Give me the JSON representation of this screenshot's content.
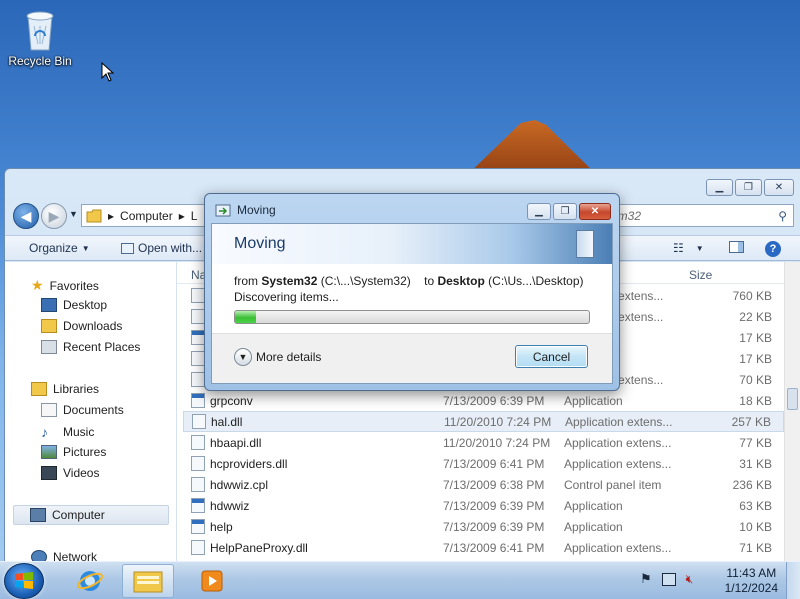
{
  "desktop": {
    "recycle_bin_label": "Recycle Bin"
  },
  "explorer": {
    "address": [
      "Computer",
      "L"
    ],
    "search_text": "em32",
    "toolbar": {
      "organize": "Organize",
      "open_with": "Open with..."
    },
    "columns": {
      "name": "Na",
      "size": "Size"
    },
    "nav": {
      "favorites": "Favorites",
      "desktop": "Desktop",
      "downloads": "Downloads",
      "recent_places": "Recent Places",
      "libraries": "Libraries",
      "documents": "Documents",
      "music": "Music",
      "pictures": "Pictures",
      "videos": "Videos",
      "computer": "Computer",
      "network": "Network"
    },
    "files": [
      {
        "name": "",
        "date": "",
        "type": "pplication extens...",
        "size": "760 KB"
      },
      {
        "name": "",
        "date": "",
        "type": "pplication extens...",
        "size": "22 KB"
      },
      {
        "name": "",
        "date": "",
        "type": "",
        "size": "17 KB"
      },
      {
        "name": "",
        "date": "",
        "type": "",
        "size": "17 KB"
      },
      {
        "name": "",
        "date": "",
        "type": "pplication extens...",
        "size": "70 KB"
      },
      {
        "name": "grpconv",
        "date": "7/13/2009 6:39 PM",
        "type": "Application",
        "size": "18 KB"
      },
      {
        "name": "hal.dll",
        "date": "11/20/2010 7:24 PM",
        "type": "Application extens...",
        "size": "257 KB"
      },
      {
        "name": "hbaapi.dll",
        "date": "11/20/2010 7:24 PM",
        "type": "Application extens...",
        "size": "77 KB"
      },
      {
        "name": "hcproviders.dll",
        "date": "7/13/2009 6:41 PM",
        "type": "Application extens...",
        "size": "31 KB"
      },
      {
        "name": "hdwwiz.cpl",
        "date": "7/13/2009 6:38 PM",
        "type": "Control panel item",
        "size": "236 KB"
      },
      {
        "name": "hdwwiz",
        "date": "7/13/2009 6:39 PM",
        "type": "Application",
        "size": "63 KB"
      },
      {
        "name": "help",
        "date": "7/13/2009 6:39 PM",
        "type": "Application",
        "size": "10 KB"
      },
      {
        "name": "HelpPaneProxy.dll",
        "date": "7/13/2009 6:41 PM",
        "type": "Application extens...",
        "size": "71 KB"
      }
    ]
  },
  "dialog": {
    "title": "Moving",
    "header": "Moving",
    "from_label": "from",
    "from_name": "System32",
    "from_path": "(C:\\...\\System32)",
    "to_label": "to",
    "to_name": "Desktop",
    "to_path": "(C:\\Us...\\Desktop)",
    "status": "Discovering items...",
    "progress": 0.06,
    "more_details": "More details",
    "cancel": "Cancel"
  },
  "taskbar": {
    "time": "11:43 AM",
    "date": "1/12/2024"
  }
}
